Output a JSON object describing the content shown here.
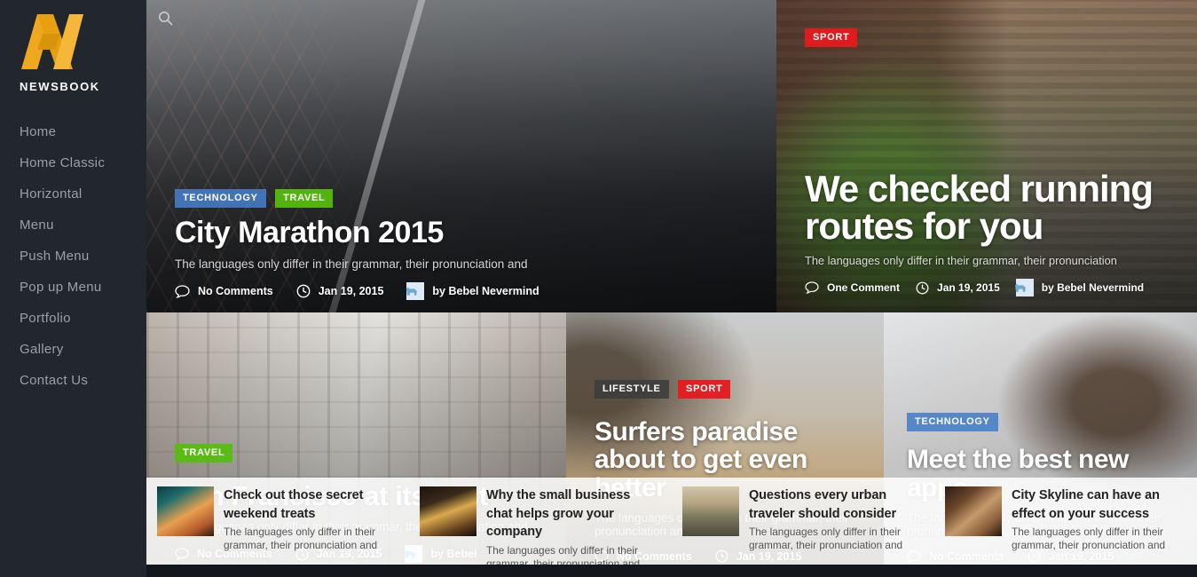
{
  "sidebar": {
    "brand": "NEWSBOOK",
    "logo_icon": "newsbook-n-logo",
    "logo_color": "#f0a81e",
    "items": [
      {
        "label": "Home"
      },
      {
        "label": "Home Classic"
      },
      {
        "label": "Horizontal"
      },
      {
        "label": "Menu"
      },
      {
        "label": "Push Menu"
      },
      {
        "label": "Pop up Menu"
      },
      {
        "label": "Portfolio"
      },
      {
        "label": "Gallery"
      },
      {
        "label": "Contact Us"
      }
    ]
  },
  "search": {
    "icon": "search-icon",
    "label": "Search"
  },
  "colors": {
    "badge_blue": "#467DC8",
    "badge_green": "#56BE0C",
    "badge_red": "#E8191E",
    "badge_dark": "#3C3C3C",
    "sidebar_bg": "#22262D",
    "accent": "#F0A81E"
  },
  "hero": {
    "city": {
      "badges": [
        {
          "label": "TECHNOLOGY",
          "color": "blue"
        },
        {
          "label": "TRAVEL",
          "color": "green"
        }
      ],
      "title": "City Marathon 2015",
      "excerpt": "The languages only differ in their grammar, their pronunciation and",
      "comments": "No Comments",
      "date": "Jan 19, 2015",
      "author": "by Bebel Nevermind"
    },
    "routes": {
      "badges": [
        {
          "label": "SPORT",
          "color": "red"
        }
      ],
      "title": "We checked running routes for you",
      "excerpt": "The languages only differ in their grammar, their pronunciation",
      "comments": "One Comment",
      "date": "Jan 19, 2015",
      "author": "by Bebel Nevermind"
    }
  },
  "middle": {
    "sanfrancisco": {
      "badges": [
        {
          "label": "TRAVEL",
          "color": "green"
        }
      ],
      "title": "San Francisco at its best",
      "excerpt": "The languages only differ in their grammar, their pronunciation and",
      "comments": "No Comments",
      "date": "Jan 19, 2015",
      "author": "by Bebel"
    },
    "surfers": {
      "badges": [
        {
          "label": "LIFESTYLE",
          "color": "dark"
        },
        {
          "label": "SPORT",
          "color": "red"
        }
      ],
      "title": "Surfers paradise about to get even better",
      "excerpt": "The languages only differ in their grammar, their pronunciation and",
      "comments": "No Comments",
      "date": "Jan 19, 2015"
    },
    "apps": {
      "badges": [
        {
          "label": "TECHNOLOGY",
          "color": "blue"
        }
      ],
      "title": "Meet the best new apps",
      "excerpt": "The languages only differ in their grammar, their pronunciation and",
      "comments": "No Comments",
      "date": "Jan 19, 2015"
    }
  },
  "latest": [
    {
      "title": "Check out those secret weekend treats",
      "excerpt": "The languages only differ in their grammar, their pronunciation and",
      "thumb": "restaurant-interior-thumb"
    },
    {
      "title": "Why the small business chat helps grow your company",
      "excerpt": "The languages only differ in their grammar, their pronunciation and",
      "thumb": "cafe-night-thumb"
    },
    {
      "title": "Questions every urban traveler should consider",
      "excerpt": "The languages only differ in their grammar, their pronunciation and",
      "thumb": "hiker-mountain-thumb"
    },
    {
      "title": "City Skyline can have an effect on your success",
      "excerpt": "The languages only differ in their grammar, their pronunciation and",
      "thumb": "hands-book-thumb"
    }
  ]
}
